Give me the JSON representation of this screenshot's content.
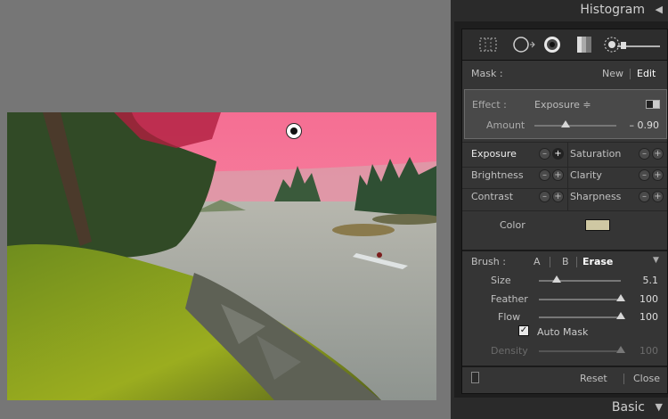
{
  "panel": {
    "histogram_title": "Histogram",
    "basic_title": "Basic",
    "collapse_icon": "triangle-left-icon",
    "expand_icon": "triangle-down-icon"
  },
  "tools": [
    "crop-overlay-icon",
    "spot-removal-icon",
    "red-eye-icon",
    "graduated-filter-icon",
    "adjustment-brush-icon"
  ],
  "mask": {
    "label": "Mask :",
    "new": "New",
    "edit": "Edit"
  },
  "effect": {
    "label": "Effect :",
    "value": "Exposure ≑",
    "amount_label": "Amount",
    "amount_value": "– 0.90",
    "amount_fraction": 0.38
  },
  "adjustments": [
    {
      "left": "Exposure",
      "right": "Saturation"
    },
    {
      "left": "Brightness",
      "right": "Clarity"
    },
    {
      "left": "Contrast",
      "right": "Sharpness"
    }
  ],
  "color": {
    "label": "Color",
    "swatch": "#cfc8a3"
  },
  "brush": {
    "label": "Brush :",
    "a": "A",
    "b": "B",
    "erase": "Erase",
    "size_label": "Size",
    "size_value": "5.1",
    "size_fraction": 0.22,
    "feather_label": "Feather",
    "feather_value": "100",
    "feather_fraction": 1.0,
    "flow_label": "Flow",
    "flow_value": "100",
    "flow_fraction": 1.0,
    "auto_mask_label": "Auto Mask",
    "auto_mask_checked": true,
    "density_label": "Density",
    "density_value": "100",
    "density_fraction": 1.0
  },
  "footer": {
    "reset": "Reset",
    "close": "Close"
  },
  "colors": {
    "mask_overlay": "#ff5f8a",
    "panel_bg": "#353535",
    "active_text": "#ffffff"
  }
}
